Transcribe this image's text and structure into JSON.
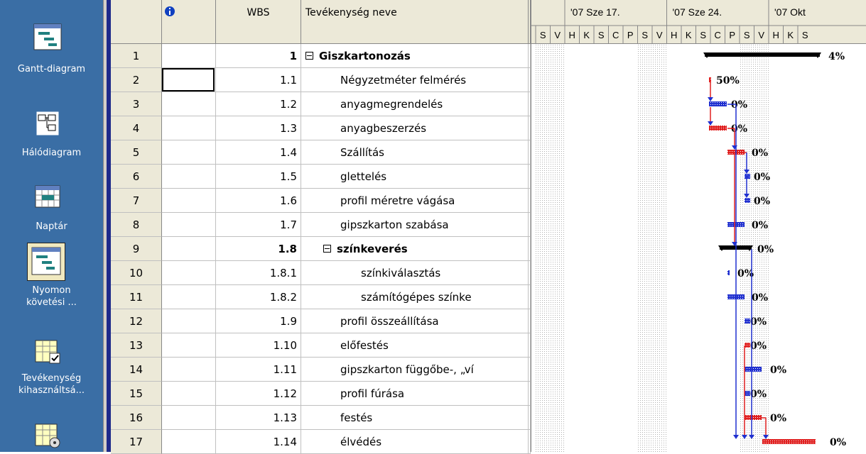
{
  "viewbar": {
    "items": [
      {
        "label": "Gantt-diagram",
        "icon": "gantt-chart-icon"
      },
      {
        "label": "Hálódiagram",
        "icon": "network-diagram-icon"
      },
      {
        "label": "Naptár",
        "icon": "calendar-icon"
      },
      {
        "label1": "Nyomon",
        "label2": "követési ...",
        "icon": "tracking-gantt-icon",
        "selected": true
      },
      {
        "label1": "Tevékenység",
        "label2": "kihasználtsá...",
        "icon": "task-usage-icon"
      },
      {
        "label": "",
        "icon": "resource-usage-icon"
      }
    ]
  },
  "table": {
    "header": {
      "indicators_icon": "info-icon",
      "wbs": "WBS",
      "name": "Tevékenység neve",
      "extra": "I"
    },
    "rows": [
      {
        "id": "1",
        "wbs": "1",
        "name": "Giszkartonozás",
        "bold": true,
        "summary": true,
        "indent": 0
      },
      {
        "id": "2",
        "wbs": "1.1",
        "name": "Négyzetméter felmérés",
        "indent": 1
      },
      {
        "id": "3",
        "wbs": "1.2",
        "name": "anyagmegrendelés",
        "indent": 1
      },
      {
        "id": "4",
        "wbs": "1.3",
        "name": "anyagbeszerzés",
        "indent": 1
      },
      {
        "id": "5",
        "wbs": "1.4",
        "name": "Szállítás",
        "indent": 1
      },
      {
        "id": "6",
        "wbs": "1.5",
        "name": "glettelés",
        "indent": 1
      },
      {
        "id": "7",
        "wbs": "1.6",
        "name": "profil méretre vágása",
        "indent": 1
      },
      {
        "id": "8",
        "wbs": "1.7",
        "name": "gipszkarton szabása",
        "indent": 1
      },
      {
        "id": "9",
        "wbs": "1.8",
        "name": "színkeverés",
        "bold": true,
        "summary": true,
        "indent": 1
      },
      {
        "id": "10",
        "wbs": "1.8.1",
        "name": "színkiválasztás",
        "indent": 2
      },
      {
        "id": "11",
        "wbs": "1.8.2",
        "name": "számítógépes színke",
        "indent": 2
      },
      {
        "id": "12",
        "wbs": "1.9",
        "name": "profil összeállítása",
        "indent": 1
      },
      {
        "id": "13",
        "wbs": "1.10",
        "name": "előfestés",
        "indent": 1
      },
      {
        "id": "14",
        "wbs": "1.11",
        "name": "gipszkarton függőbe-, „ví",
        "indent": 1
      },
      {
        "id": "15",
        "wbs": "1.12",
        "name": "profil fúrása",
        "indent": 1
      },
      {
        "id": "16",
        "wbs": "1.13",
        "name": "festés",
        "indent": 1
      },
      {
        "id": "17",
        "wbs": "1.14",
        "name": "élvédés",
        "indent": 1
      }
    ]
  },
  "gantt": {
    "weeks": [
      "'07 Sze 17.",
      "'07 Sze 24.",
      "'07 Okt"
    ],
    "days": [
      "S",
      "V",
      "H",
      "K",
      "S",
      "C",
      "P",
      "S",
      "V",
      "H",
      "K",
      "S",
      "C",
      "P",
      "S",
      "V",
      "H",
      "K",
      "S"
    ],
    "percents": [
      "4%",
      "50%",
      "0%",
      "0%",
      "0%",
      "0%",
      "0%",
      "0%",
      "0%",
      "0%",
      "0%",
      "0%",
      "0%",
      "0%",
      "0%",
      "0%",
      "0%"
    ],
    "colors": {
      "critical": "#e02020",
      "normal": "#2030d0",
      "summary": "#000000",
      "weekend": "#c8c8c8"
    }
  }
}
